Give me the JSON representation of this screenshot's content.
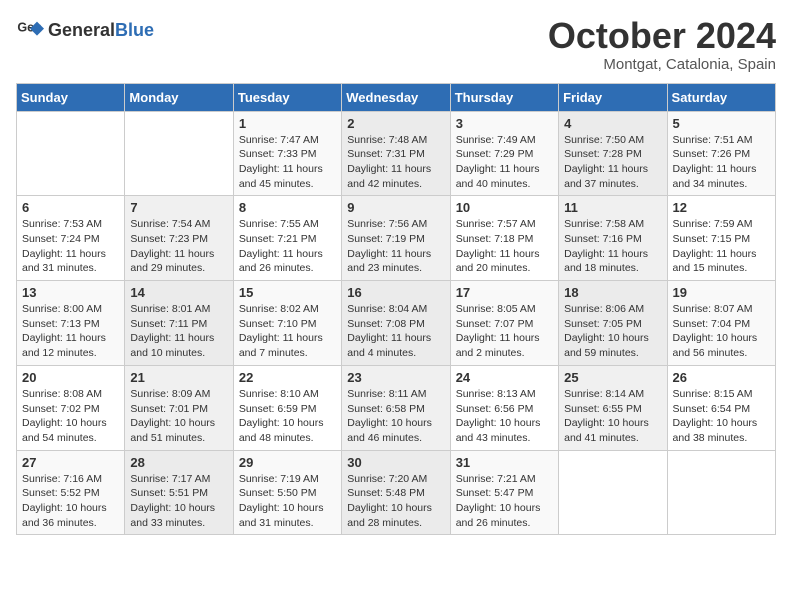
{
  "header": {
    "logo_general": "General",
    "logo_blue": "Blue",
    "month_title": "October 2024",
    "location": "Montgat, Catalonia, Spain"
  },
  "days_of_week": [
    "Sunday",
    "Monday",
    "Tuesday",
    "Wednesday",
    "Thursday",
    "Friday",
    "Saturday"
  ],
  "weeks": [
    [
      {
        "day": "",
        "info": ""
      },
      {
        "day": "",
        "info": ""
      },
      {
        "day": "1",
        "info": "Sunrise: 7:47 AM\nSunset: 7:33 PM\nDaylight: 11 hours and 45 minutes."
      },
      {
        "day": "2",
        "info": "Sunrise: 7:48 AM\nSunset: 7:31 PM\nDaylight: 11 hours and 42 minutes."
      },
      {
        "day": "3",
        "info": "Sunrise: 7:49 AM\nSunset: 7:29 PM\nDaylight: 11 hours and 40 minutes."
      },
      {
        "day": "4",
        "info": "Sunrise: 7:50 AM\nSunset: 7:28 PM\nDaylight: 11 hours and 37 minutes."
      },
      {
        "day": "5",
        "info": "Sunrise: 7:51 AM\nSunset: 7:26 PM\nDaylight: 11 hours and 34 minutes."
      }
    ],
    [
      {
        "day": "6",
        "info": "Sunrise: 7:53 AM\nSunset: 7:24 PM\nDaylight: 11 hours and 31 minutes."
      },
      {
        "day": "7",
        "info": "Sunrise: 7:54 AM\nSunset: 7:23 PM\nDaylight: 11 hours and 29 minutes."
      },
      {
        "day": "8",
        "info": "Sunrise: 7:55 AM\nSunset: 7:21 PM\nDaylight: 11 hours and 26 minutes."
      },
      {
        "day": "9",
        "info": "Sunrise: 7:56 AM\nSunset: 7:19 PM\nDaylight: 11 hours and 23 minutes."
      },
      {
        "day": "10",
        "info": "Sunrise: 7:57 AM\nSunset: 7:18 PM\nDaylight: 11 hours and 20 minutes."
      },
      {
        "day": "11",
        "info": "Sunrise: 7:58 AM\nSunset: 7:16 PM\nDaylight: 11 hours and 18 minutes."
      },
      {
        "day": "12",
        "info": "Sunrise: 7:59 AM\nSunset: 7:15 PM\nDaylight: 11 hours and 15 minutes."
      }
    ],
    [
      {
        "day": "13",
        "info": "Sunrise: 8:00 AM\nSunset: 7:13 PM\nDaylight: 11 hours and 12 minutes."
      },
      {
        "day": "14",
        "info": "Sunrise: 8:01 AM\nSunset: 7:11 PM\nDaylight: 11 hours and 10 minutes."
      },
      {
        "day": "15",
        "info": "Sunrise: 8:02 AM\nSunset: 7:10 PM\nDaylight: 11 hours and 7 minutes."
      },
      {
        "day": "16",
        "info": "Sunrise: 8:04 AM\nSunset: 7:08 PM\nDaylight: 11 hours and 4 minutes."
      },
      {
        "day": "17",
        "info": "Sunrise: 8:05 AM\nSunset: 7:07 PM\nDaylight: 11 hours and 2 minutes."
      },
      {
        "day": "18",
        "info": "Sunrise: 8:06 AM\nSunset: 7:05 PM\nDaylight: 10 hours and 59 minutes."
      },
      {
        "day": "19",
        "info": "Sunrise: 8:07 AM\nSunset: 7:04 PM\nDaylight: 10 hours and 56 minutes."
      }
    ],
    [
      {
        "day": "20",
        "info": "Sunrise: 8:08 AM\nSunset: 7:02 PM\nDaylight: 10 hours and 54 minutes."
      },
      {
        "day": "21",
        "info": "Sunrise: 8:09 AM\nSunset: 7:01 PM\nDaylight: 10 hours and 51 minutes."
      },
      {
        "day": "22",
        "info": "Sunrise: 8:10 AM\nSunset: 6:59 PM\nDaylight: 10 hours and 48 minutes."
      },
      {
        "day": "23",
        "info": "Sunrise: 8:11 AM\nSunset: 6:58 PM\nDaylight: 10 hours and 46 minutes."
      },
      {
        "day": "24",
        "info": "Sunrise: 8:13 AM\nSunset: 6:56 PM\nDaylight: 10 hours and 43 minutes."
      },
      {
        "day": "25",
        "info": "Sunrise: 8:14 AM\nSunset: 6:55 PM\nDaylight: 10 hours and 41 minutes."
      },
      {
        "day": "26",
        "info": "Sunrise: 8:15 AM\nSunset: 6:54 PM\nDaylight: 10 hours and 38 minutes."
      }
    ],
    [
      {
        "day": "27",
        "info": "Sunrise: 7:16 AM\nSunset: 5:52 PM\nDaylight: 10 hours and 36 minutes."
      },
      {
        "day": "28",
        "info": "Sunrise: 7:17 AM\nSunset: 5:51 PM\nDaylight: 10 hours and 33 minutes."
      },
      {
        "day": "29",
        "info": "Sunrise: 7:19 AM\nSunset: 5:50 PM\nDaylight: 10 hours and 31 minutes."
      },
      {
        "day": "30",
        "info": "Sunrise: 7:20 AM\nSunset: 5:48 PM\nDaylight: 10 hours and 28 minutes."
      },
      {
        "day": "31",
        "info": "Sunrise: 7:21 AM\nSunset: 5:47 PM\nDaylight: 10 hours and 26 minutes."
      },
      {
        "day": "",
        "info": ""
      },
      {
        "day": "",
        "info": ""
      }
    ]
  ]
}
